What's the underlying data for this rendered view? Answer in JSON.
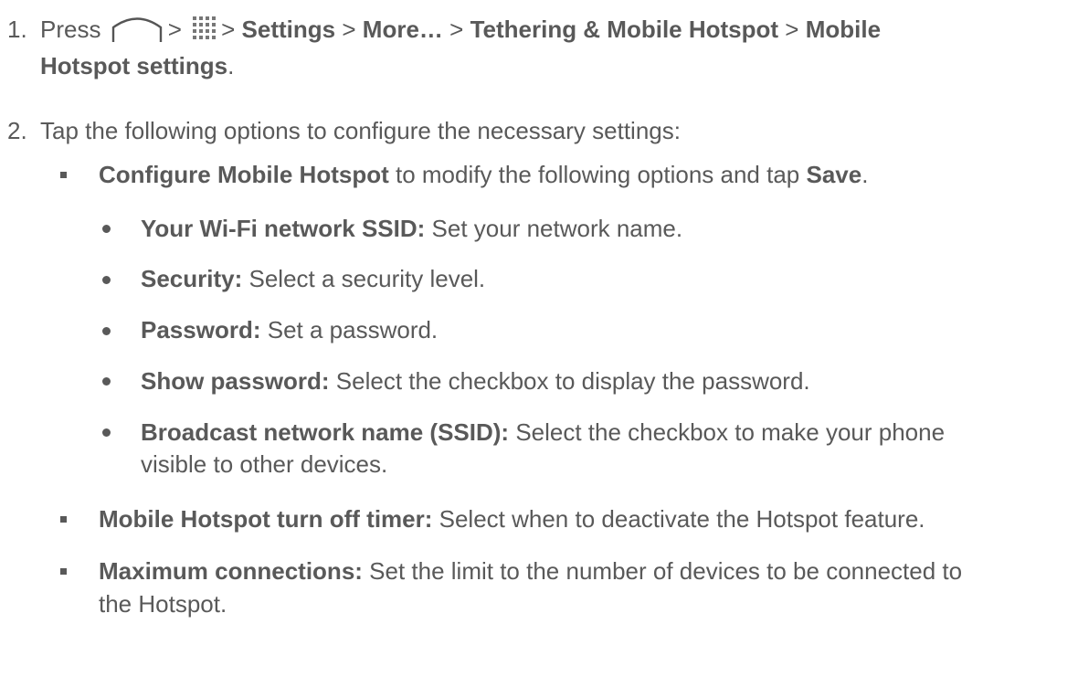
{
  "step1": {
    "number": "1.",
    "press": "Press",
    "sep": ">",
    "settings": "Settings",
    "more": "More…",
    "tethering": "Tethering & Mobile Hotspot",
    "mobile": "Mobile",
    "hotspot_settings": "Hotspot settings",
    "period": ".",
    "icons": [
      "home-icon",
      "apps-icon"
    ]
  },
  "step2": {
    "number": "2.",
    "text": "Tap the following options to configure the necessary settings:"
  },
  "configure": {
    "bold": "Configure Mobile Hotspot",
    "text": " to modify the following options and tap ",
    "save": "Save",
    "period": "."
  },
  "options": [
    {
      "bold": "Your Wi-Fi network SSID:",
      "text": " Set your network name."
    },
    {
      "bold": "Security:",
      "text": " Select a security level."
    },
    {
      "bold": "Password:",
      "text": " Set a password."
    },
    {
      "bold": "Show password:",
      "text": " Select the checkbox to display the password."
    },
    {
      "bold": "Broadcast network name (SSID):",
      "text": " Select the checkbox to make your phone",
      "text2": "visible to other devices."
    }
  ],
  "timer": {
    "bold": "Mobile Hotspot turn off timer:",
    "text": " Select when to deactivate the Hotspot feature."
  },
  "maxconn": {
    "bold": "Maximum connections:",
    "text": " Set the limit to the number of devices to be connected to",
    "text2": "the Hotspot."
  }
}
